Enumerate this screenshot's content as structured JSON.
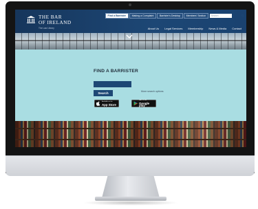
{
  "brand": {
    "name_line1": "THE BAR",
    "name_line2": "OF IRELAND",
    "tagline": "The Law Library",
    "colors": {
      "navy": "#1d4775",
      "panel": "#a9dde2"
    }
  },
  "top_links": [
    {
      "label": "Find a Barrister",
      "active": true
    },
    {
      "label": "Making a Complaint",
      "active": false
    },
    {
      "label": "Barrister's Desktop",
      "active": false
    },
    {
      "label": "Members' Section",
      "active": false
    }
  ],
  "search": {
    "placeholder": "Search",
    "icon": "search-icon"
  },
  "main_nav": [
    "About Us",
    "Legal Services",
    "Membership",
    "News & Media",
    "Contact"
  ],
  "finder": {
    "title": "FIND A BARRISTER",
    "search_label": "Search",
    "more_options": "More search options",
    "app_store": {
      "small": "Available on the",
      "big": "App Store",
      "icon": "apple-icon"
    },
    "google_play": {
      "small": "GET IT ON",
      "big": "Google play",
      "icon": "play-icon"
    }
  }
}
